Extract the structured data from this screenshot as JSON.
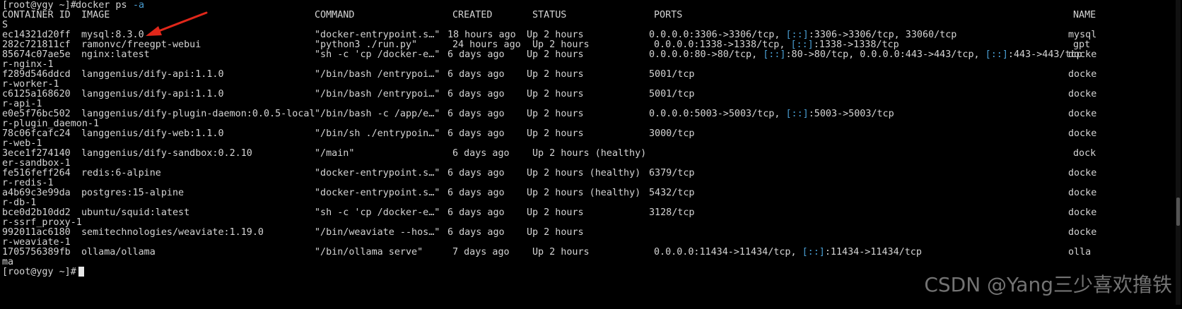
{
  "prompt": {
    "user_host": "[root@ygy ~]#",
    "command": "docker ps -a",
    "cmd_name": "docker ps",
    "cmd_flag": "-a"
  },
  "headers": {
    "container_id": "CONTAINER ID",
    "image": "IMAGE",
    "command": "COMMAND",
    "created": "CREATED",
    "status": "STATUS",
    "ports": "PORTS",
    "names": "NAME",
    "names_wrap": "S"
  },
  "rows": [
    {
      "id": "ec14321d20ff",
      "image": "mysql:8.3.0",
      "command": "\"docker-entrypoint.s…\"",
      "created": "18 hours ago",
      "status": "Up 2 hours",
      "ports": [
        [
          "0.0.0.0:3306->3306/tcp, ",
          ""
        ],
        [
          "[::]",
          "ipv6"
        ],
        [
          ":3306->3306/tcp, 33060/tcp",
          ""
        ]
      ],
      "name": "mysql",
      "name_wrap": ""
    },
    {
      "id": "282c721811cf",
      "image": "ramonvc/freegpt-webui",
      "command": "\"python3 ./run.py\"",
      "created": "24 hours ago",
      "status": "Up 2 hours",
      "ports": [
        [
          "0.0.0.0:1338->1338/tcp, ",
          ""
        ],
        [
          "[::]",
          "ipv6"
        ],
        [
          ":1338->1338/tcp",
          ""
        ]
      ],
      "name": "gpt",
      "name_wrap": ""
    },
    {
      "id": "85674c07ae5e",
      "image": "nginx:latest",
      "command": "\"sh -c 'cp /docker-e…\"",
      "created": "6 days ago",
      "status": "Up 2 hours",
      "ports": [
        [
          "0.0.0.0:80->80/tcp, ",
          ""
        ],
        [
          "[::]",
          "ipv6"
        ],
        [
          ":80->80/tcp, 0.0.0.0:443->443/tcp, ",
          ""
        ],
        [
          "[::]",
          "ipv6"
        ],
        [
          ":443->443/tcp",
          ""
        ]
      ],
      "name": "docke",
      "name_wrap": "r-nginx-1"
    },
    {
      "id": "f289d546ddcd",
      "image": "langgenius/dify-api:1.1.0",
      "command": "\"/bin/bash /entrypoi…\"",
      "created": "6 days ago",
      "status": "Up 2 hours",
      "ports": [
        [
          "5001/tcp",
          ""
        ]
      ],
      "name": "docke",
      "name_wrap": "r-worker-1"
    },
    {
      "id": "c6125a168620",
      "image": "langgenius/dify-api:1.1.0",
      "command": "\"/bin/bash /entrypoi…\"",
      "created": "6 days ago",
      "status": "Up 2 hours",
      "ports": [
        [
          "5001/tcp",
          ""
        ]
      ],
      "name": "docke",
      "name_wrap": "r-api-1"
    },
    {
      "id": "e0e5f76bc502",
      "image": "langgenius/dify-plugin-daemon:0.0.5-local",
      "command": "\"/bin/bash -c /app/e…\"",
      "created": "6 days ago",
      "status": "Up 2 hours",
      "ports": [
        [
          "0.0.0.0:5003->5003/tcp, ",
          ""
        ],
        [
          "[::]",
          "ipv6"
        ],
        [
          ":5003->5003/tcp",
          ""
        ]
      ],
      "name": "docke",
      "name_wrap": "r-plugin_daemon-1"
    },
    {
      "id": "78c06fcafc24",
      "image": "langgenius/dify-web:1.1.0",
      "command": "\"/bin/sh ./entrypoin…\"",
      "created": "6 days ago",
      "status": "Up 2 hours",
      "ports": [
        [
          "3000/tcp",
          ""
        ]
      ],
      "name": "docke",
      "name_wrap": "r-web-1"
    },
    {
      "id": "3ece1f274140",
      "image": "langgenius/dify-sandbox:0.2.10",
      "command": "\"/main\"",
      "created": "6 days ago",
      "status": "Up 2 hours (healthy)",
      "ports": [],
      "name": "dock",
      "name_wrap": "er-sandbox-1"
    },
    {
      "id": "fe516feff264",
      "image": "redis:6-alpine",
      "command": "\"docker-entrypoint.s…\"",
      "created": "6 days ago",
      "status": "Up 2 hours (healthy)",
      "ports": [
        [
          "6379/tcp",
          ""
        ]
      ],
      "name": "docke",
      "name_wrap": "r-redis-1"
    },
    {
      "id": "a4b69c3e99da",
      "image": "postgres:15-alpine",
      "command": "\"docker-entrypoint.s…\"",
      "created": "6 days ago",
      "status": "Up 2 hours (healthy)",
      "ports": [
        [
          "5432/tcp",
          ""
        ]
      ],
      "name": "docke",
      "name_wrap": "r-db-1"
    },
    {
      "id": "bce0d2b10dd2",
      "image": "ubuntu/squid:latest",
      "command": "\"sh -c 'cp /docker-e…\"",
      "created": "6 days ago",
      "status": "Up 2 hours",
      "ports": [
        [
          "3128/tcp",
          ""
        ]
      ],
      "name": "docke",
      "name_wrap": "r-ssrf_proxy-1"
    },
    {
      "id": "992011ac6180",
      "image": "semitechnologies/weaviate:1.19.0",
      "command": "\"/bin/weaviate --hos…\"",
      "created": "6 days ago",
      "status": "Up 2 hours",
      "ports": [],
      "name": "docke",
      "name_wrap": "r-weaviate-1"
    },
    {
      "id": "1705756389fb",
      "image": "ollama/ollama",
      "command": "\"/bin/ollama serve\"",
      "created": "7 days ago",
      "status": "Up 2 hours",
      "ports": [
        [
          "0.0.0.0:11434->11434/tcp, ",
          ""
        ],
        [
          "[::]",
          "ipv6"
        ],
        [
          ":11434->11434/tcp",
          ""
        ]
      ],
      "name": "olla",
      "name_wrap": "ma"
    }
  ],
  "final_prompt": "[root@ygy ~]#",
  "watermark": "CSDN @Yang三少喜欢撸铁",
  "colors": {
    "background": "#000000",
    "text": "#d4d4d4",
    "ipv6": "#4a9fd4",
    "arrow": "#e0271a"
  }
}
